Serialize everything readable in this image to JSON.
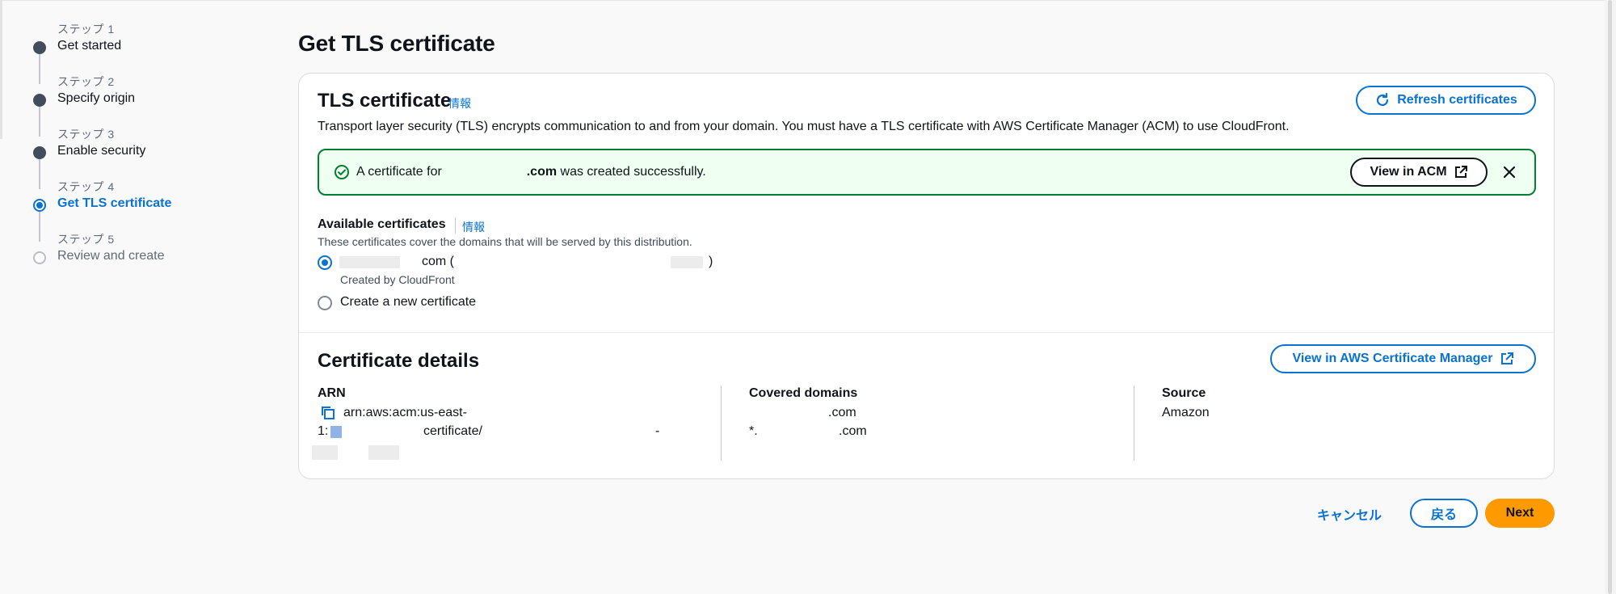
{
  "steps": [
    {
      "num": "ステップ 1",
      "name": "Get started",
      "state": "done"
    },
    {
      "num": "ステップ 2",
      "name": "Specify origin",
      "state": "done"
    },
    {
      "num": "ステップ 3",
      "name": "Enable security",
      "state": "done"
    },
    {
      "num": "ステップ 4",
      "name": "Get TLS certificate",
      "state": "current"
    },
    {
      "num": "ステップ 5",
      "name": "Review and create",
      "state": "upcoming"
    }
  ],
  "page_title": "Get TLS certificate",
  "tls": {
    "title": "TLS certificate",
    "info": "情報",
    "description": "Transport layer security (TLS) encrypts communication to and from your domain. You must have a TLS certificate with AWS Certificate Manager (ACM) to use CloudFront.",
    "refresh_label": "Refresh certificates"
  },
  "flash": {
    "prefix": "A certificate for",
    "domain": ".com",
    "suffix": "was created successfully.",
    "view_label": "View in ACM"
  },
  "available": {
    "label": "Available certificates",
    "info": "情報",
    "description": "These certificates cover the domains that will be served by this distribution.",
    "options": [
      {
        "label": "com (",
        "label_end": ")",
        "sub": "Created by CloudFront",
        "selected": true
      },
      {
        "label": "Create a new certificate",
        "selected": false
      }
    ]
  },
  "details": {
    "title": "Certificate details",
    "view_label": "View in AWS Certificate Manager",
    "arn_label": "ARN",
    "arn_line1": "arn:aws:acm:us-east-",
    "arn_line2_prefix": "1:",
    "arn_line2_mid": "certificate/",
    "arn_line2_end": "-",
    "domains_label": "Covered domains",
    "domain1": ".com",
    "domain2_prefix": "*.",
    "domain2_suffix": ".com",
    "source_label": "Source",
    "source_value": "Amazon"
  },
  "footer": {
    "cancel": "キャンセル",
    "back": "戻る",
    "next": "Next"
  },
  "colors": {
    "accent": "#0972d3",
    "success": "#00802f",
    "primary": "#ff9900"
  }
}
